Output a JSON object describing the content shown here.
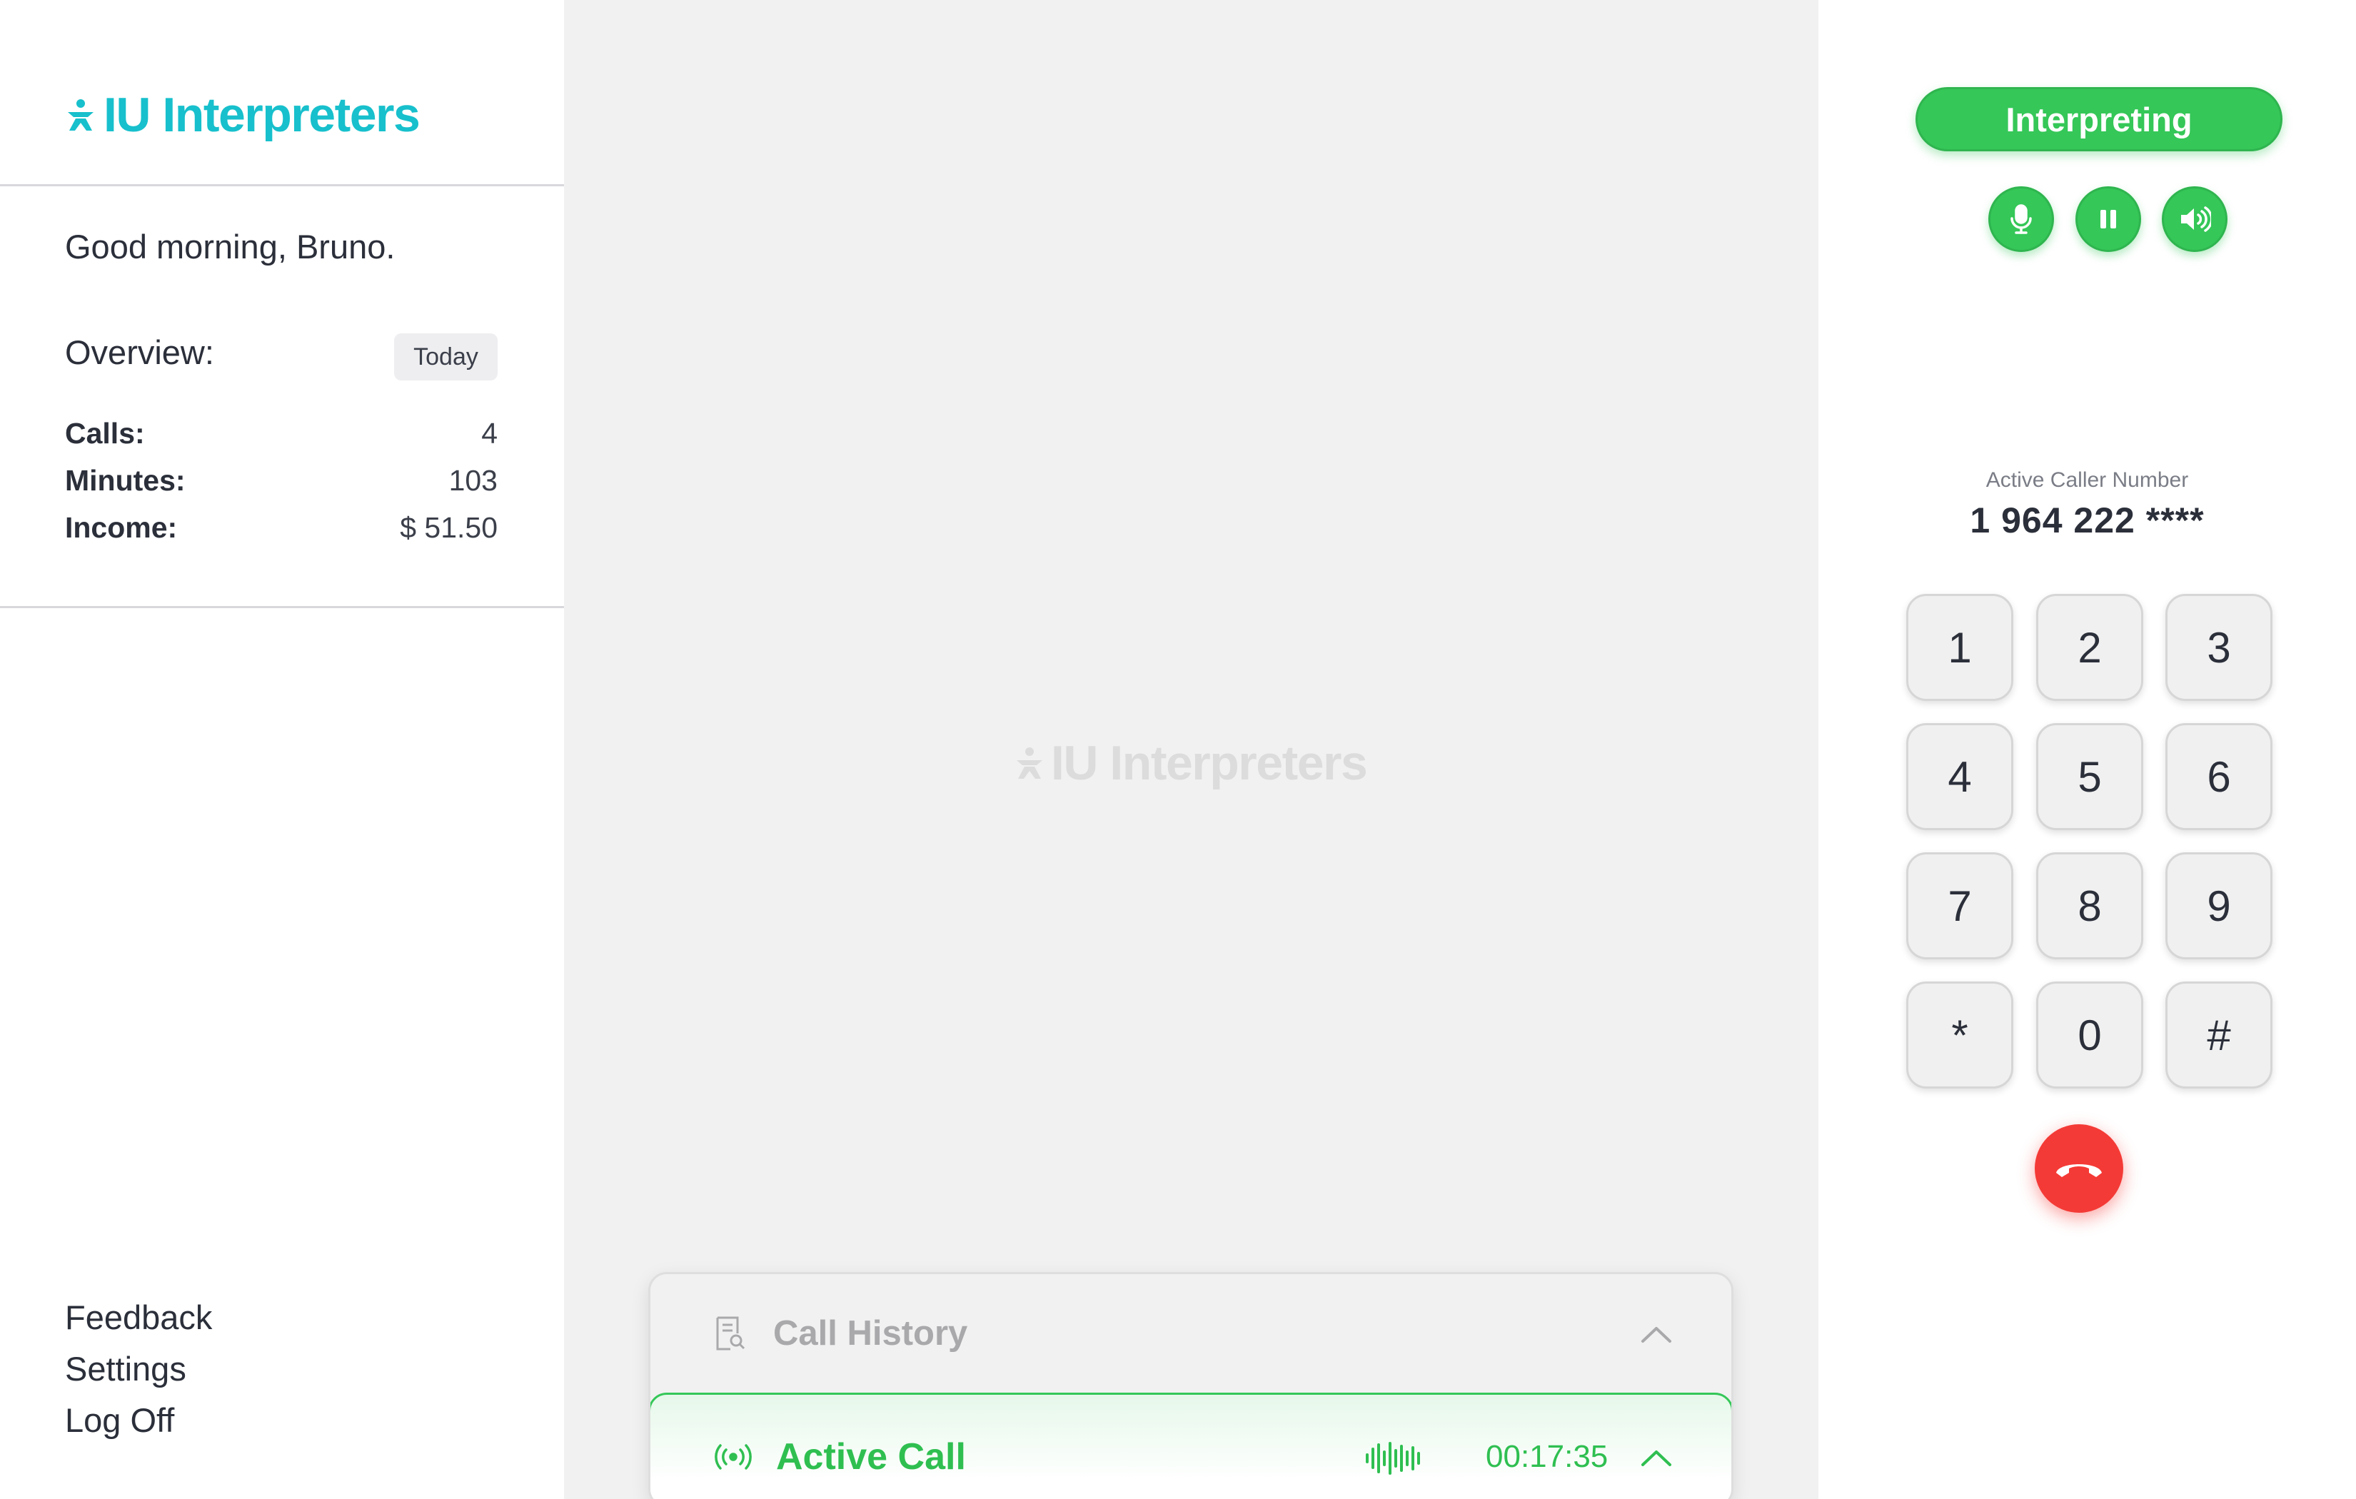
{
  "brand": {
    "name": "IU Interpreters",
    "color": "#17c0cc"
  },
  "sidebar": {
    "greeting": "Good morning, Bruno.",
    "overview": {
      "title": "Overview:",
      "period": "Today",
      "stats": [
        {
          "label": "Calls:",
          "value": "4"
        },
        {
          "label": "Minutes:",
          "value": "103"
        },
        {
          "label": "Income:",
          "value": "$ 51.50"
        }
      ]
    },
    "links": [
      "Feedback",
      "Settings",
      "Log Off"
    ]
  },
  "center": {
    "watermark": "IU Interpreters",
    "call_history": {
      "title": "Call History"
    },
    "active_call": {
      "title": "Active Call",
      "timer": "00:17:35"
    }
  },
  "right": {
    "status_button": "Interpreting",
    "controls": [
      "microphone-icon",
      "pause-icon",
      "speaker-icon"
    ],
    "caller_label": "Active Caller Number",
    "caller_number": "1 964 222 ****",
    "keypad": [
      "1",
      "2",
      "3",
      "4",
      "5",
      "6",
      "7",
      "8",
      "9",
      "*",
      "0",
      "#"
    ],
    "hangup_icon": "phone-hangup-icon"
  },
  "colors": {
    "accent_green": "#35c758",
    "hangup_red": "#f43a36"
  }
}
